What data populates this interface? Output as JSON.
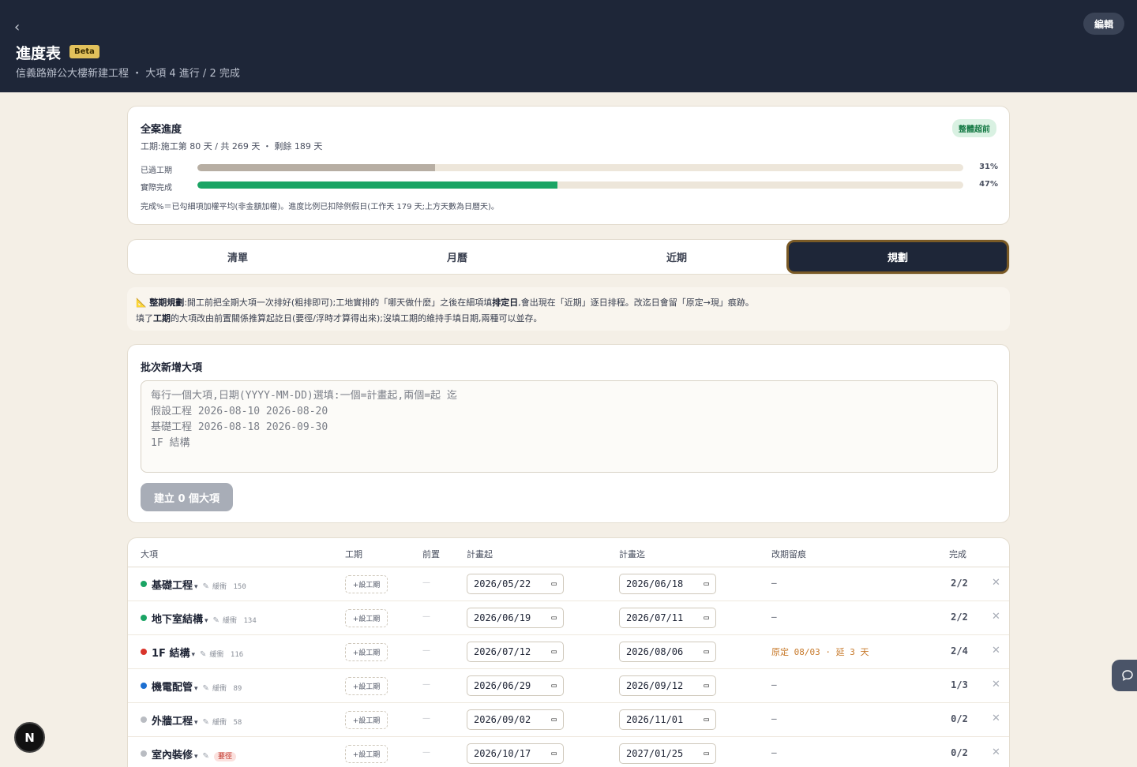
{
  "header": {
    "back_icon": "‹",
    "title": "進度表",
    "beta": "Beta",
    "subtitle": "信義路辦公大樓新建工程 ・ 大項 4 進行 / 2 完成",
    "edit_label": "編輯"
  },
  "overall": {
    "title": "全案進度",
    "badge": "整體超前",
    "subtitle": "工期:施工第 80 天 / 共 269 天 ・ 剩餘 189 天",
    "elapsed_label": "已過工期",
    "elapsed_pct": "31%",
    "elapsed_value": 31,
    "actual_label": "實際完成",
    "actual_pct": "47%",
    "actual_value": 47,
    "note": "完成%＝已勾細項加權平均(非金額加權)。進度比例已扣除例假日(工作天 179 天;上方天數為日曆天)。",
    "colors": {
      "elapsed": "#b7aea3",
      "actual": "#1aa464"
    }
  },
  "tabs": [
    "清單",
    "月曆",
    "近期",
    "規劃"
  ],
  "info": {
    "icon": "📐",
    "line1_bold": "整期規劃",
    "line1_a": ":開工前把全期大項一次排好(粗排即可);工地實排的「哪天做什麼」之後在細項填",
    "line1_bold2": "排定日",
    "line1_b": ",會出現在「近期」逐日排程。改迄日會留「原定→現」痕跡。",
    "line2_a": "填了",
    "line2_bold": "工期",
    "line2_b": "的大項改由前置關係推算起訖日(要徑/浮時才算得出來);沒填工期的維持手填日期,兩種可以並存。"
  },
  "batch": {
    "title": "批次新增大項",
    "textarea_value": "每行一個大項,日期(YYYY-MM-DD)選填:一個=計畫起,兩個=起 迄\n假設工程 2026-08-10 2026-08-20\n基礎工程 2026-08-18 2026-09-30\n1F 結構",
    "button_label": "建立 0 個大項"
  },
  "table": {
    "headers": {
      "item": "大項",
      "duration": "工期",
      "pre": "前置",
      "start": "計畫起",
      "end": "計畫迄",
      "trace": "改期留痕",
      "done": "完成"
    },
    "add_duration_label": "+設工期",
    "pre_placeholder": "—",
    "buffer_label": "緩衝",
    "critical_label": "要徑",
    "rows": [
      {
        "name": "基礎工程",
        "dot": "#1aa464",
        "buffer": "150",
        "start": "2026/05/22",
        "end": "2026/06/18",
        "trace": "—",
        "done": "2/2"
      },
      {
        "name": "地下室結構",
        "dot": "#1aa464",
        "buffer": "134",
        "start": "2026/06/19",
        "end": "2026/07/11",
        "trace": "—",
        "done": "2/2"
      },
      {
        "name": "1F 結構",
        "dot": "#d9342b",
        "buffer": "116",
        "start": "2026/07/12",
        "end": "2026/08/06",
        "trace": "原定 08/03 · 延 3 天",
        "done": "2/4"
      },
      {
        "name": "機電配管",
        "dot": "#1d6fd1",
        "buffer": "89",
        "start": "2026/06/29",
        "end": "2026/09/12",
        "trace": "—",
        "done": "1/3"
      },
      {
        "name": "外牆工程",
        "dot": "#b9bcc2",
        "buffer": "58",
        "start": "2026/09/02",
        "end": "2026/11/01",
        "trace": "—",
        "done": "0/2"
      },
      {
        "name": "室內裝修",
        "dot": "#b9bcc2",
        "buffer": "",
        "start": "2026/10/17",
        "end": "2027/01/25",
        "trace": "—",
        "done": "0/2"
      }
    ]
  },
  "floating": {
    "chat_icon": "speech-bubble-icon",
    "n_badge": "N"
  }
}
